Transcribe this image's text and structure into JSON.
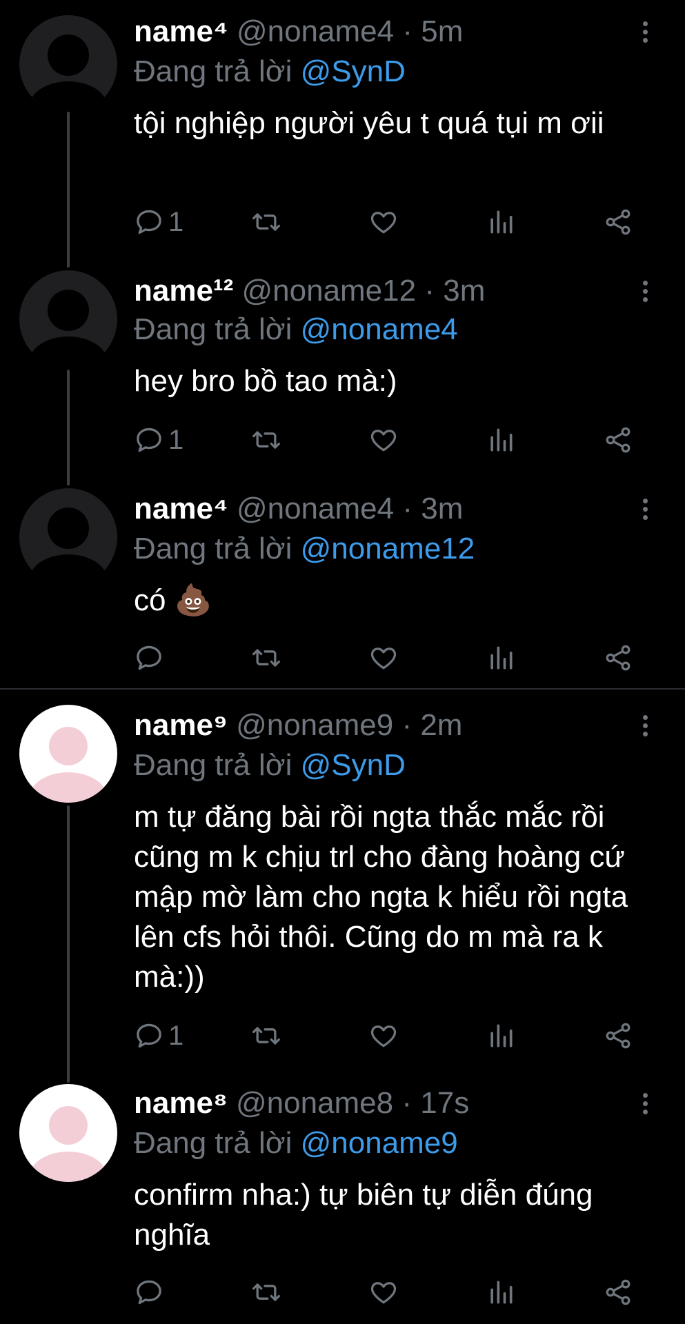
{
  "icons": {
    "reply": "speech-bubble-icon",
    "retweet": "retweet-icon",
    "like": "heart-icon",
    "views": "bar-chart-icon",
    "share": "share-icon",
    "more": "vertical-dots-icon"
  },
  "colors": {
    "background": "#000000",
    "muted": "#6f767d",
    "mention": "#3d9be9",
    "text": "#ffffff"
  },
  "tweets": [
    {
      "name": "name⁴",
      "handle": "@noname4",
      "sep": " · ",
      "time": "5m",
      "reply_prefix": "Đang trả lời ",
      "reply_to": "@SynD",
      "text": "tội nghiệp người yêu t quá tụi m ơii",
      "reply_count": "1"
    },
    {
      "name": "name¹²",
      "handle": "@noname12",
      "sep": " · ",
      "time": "3m",
      "reply_prefix": "Đang trả lời ",
      "reply_to": "@noname4",
      "text": "hey bro bồ tao mà:)",
      "reply_count": "1"
    },
    {
      "name": "name⁴",
      "handle": "@noname4",
      "sep": " · ",
      "time": "3m",
      "reply_prefix": "Đang trả lời ",
      "reply_to": "@noname12",
      "text": "có 💩",
      "reply_count": ""
    },
    {
      "name": "name⁹",
      "handle": "@noname9",
      "sep": " · ",
      "time": "2m",
      "reply_prefix": "Đang trả lời ",
      "reply_to": "@SynD",
      "text": "m tự đăng bài rồi ngta thắc mắc rồi cũng m k chịu trl cho đàng hoàng cứ mập mờ làm cho ngta k hiểu rồi ngta lên cfs hỏi thôi. Cũng do m mà ra k mà:))",
      "reply_count": "1"
    },
    {
      "name": "name⁸",
      "handle": "@noname8",
      "sep": " · ",
      "time": "17s",
      "reply_prefix": "Đang trả lời ",
      "reply_to": "@noname9",
      "text": "confirm nha:) tự biên tự diễn đúng nghĩa",
      "reply_count": ""
    }
  ]
}
